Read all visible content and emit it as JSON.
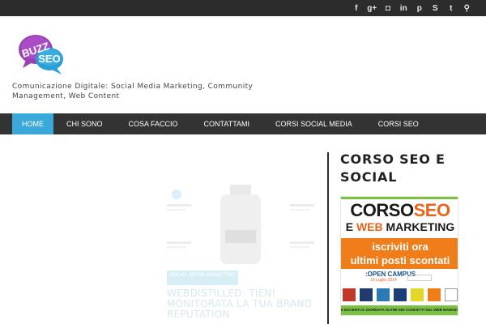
{
  "social_icons": [
    {
      "name": "facebook-icon",
      "glyph": "f"
    },
    {
      "name": "google-plus-icon",
      "glyph": "g+"
    },
    {
      "name": "instagram-icon",
      "glyph": "◘"
    },
    {
      "name": "linkedin-icon",
      "glyph": "in"
    },
    {
      "name": "pinterest-icon",
      "glyph": "p"
    },
    {
      "name": "skype-icon",
      "glyph": "S"
    },
    {
      "name": "twitter-icon",
      "glyph": "t"
    },
    {
      "name": "search-icon",
      "glyph": "⚲"
    }
  ],
  "logo": {
    "line1": "BUZZ",
    "line2": "SEO"
  },
  "header": {
    "tagline": "Comunicazione Digitale: Social Media Marketing, Community Management, Web Content"
  },
  "nav": {
    "items": [
      {
        "label": "HOME",
        "active": true
      },
      {
        "label": "CHI SONO"
      },
      {
        "label": "COSA FACCIO"
      },
      {
        "label": "CONTATTAMI"
      },
      {
        "label": "CORSI SOCIAL MEDIA"
      },
      {
        "label": "CORSI SEO"
      }
    ]
  },
  "post": {
    "badge": "SOCIAL MEDIA MARKETING",
    "title": "WEBDISTILLED: TIENI MONITORATA LA TUA BRAND REPUTATION"
  },
  "sidebar": {
    "widget_title": "CORSO SEO E SOCIAL",
    "banner": {
      "line1_a": "CORSO",
      "line1_b": "SEO",
      "line2_a": "E ",
      "line2_b": "WEB ",
      "line2_c": "MARKETING",
      "cta_line1": "iscriviti ora",
      "cta_line2": "ultimi posti scontati",
      "event": ":OPEN CAMPUS",
      "date": "19 Luglio 2014",
      "footer": "5 DOCENTI in GIORNATA OLTRE 500 CONCETTI SUL WEB MARKETING"
    }
  },
  "colors": {
    "accent_blue": "#3aa8d8",
    "nav_bg": "#333333",
    "topbar_bg": "#2c2c2c",
    "banner_green": "#7cc242",
    "banner_orange": "#ef7d1a"
  }
}
